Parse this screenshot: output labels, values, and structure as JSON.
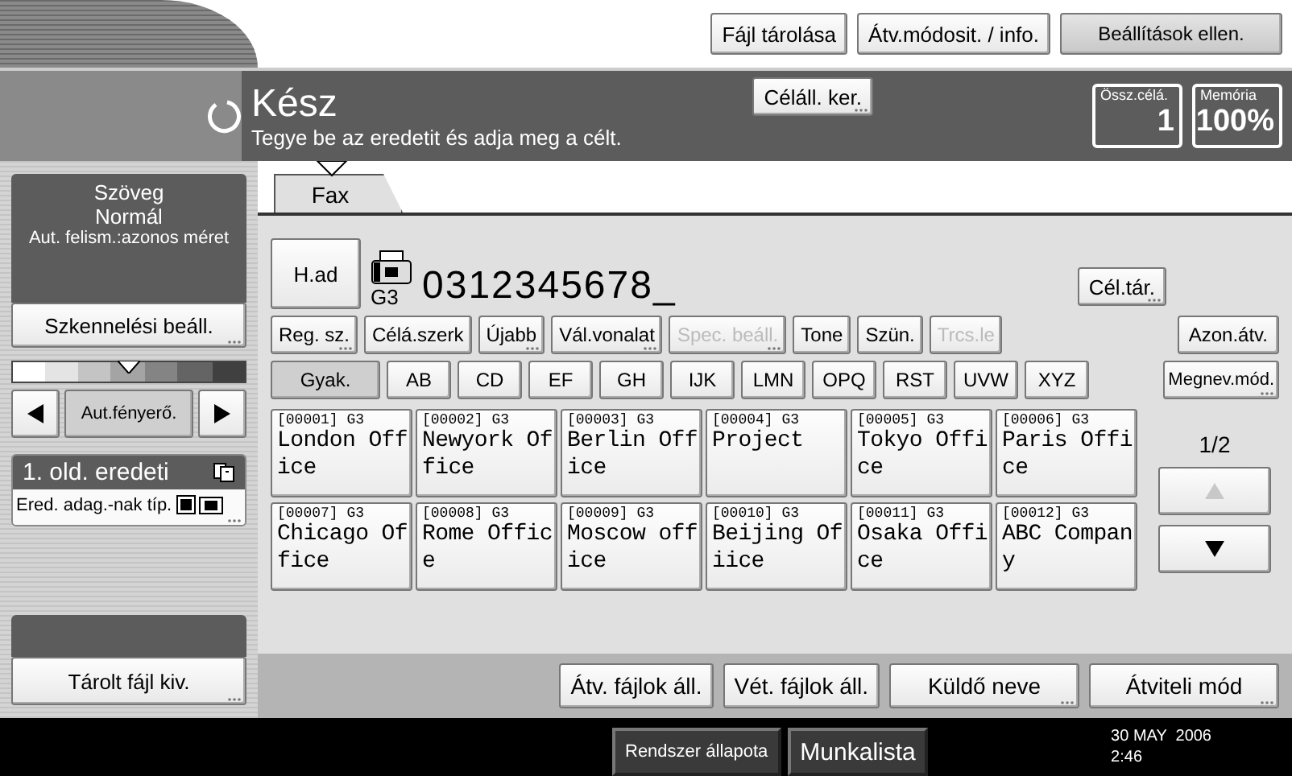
{
  "top_buttons": [
    {
      "label": "Fájl tárolása",
      "kind": "plain"
    },
    {
      "label": "Átv.módosit. / info.",
      "kind": "plain"
    },
    {
      "label": "Beállítások ellen.",
      "kind": "shaded"
    }
  ],
  "status": {
    "title": "Kész",
    "message": "Tegye be az eredetit és adja meg a célt.",
    "button": {
      "label": "Céláll. ker.",
      "more": true
    },
    "counters": [
      {
        "label": "Össz.célá.",
        "value": "1"
      },
      {
        "label": "Memória",
        "value": "100%"
      }
    ]
  },
  "left": {
    "settings": [
      "Szöveg",
      "Normál",
      "Aut. felism.:azonos méret"
    ],
    "scan_button": {
      "label": "Szkennelési beáll.",
      "more": true
    },
    "density": {
      "level": 0.5,
      "button": "Aut.fényerő."
    },
    "original": {
      "title": "1. old. eredeti",
      "button": "Ered. adag.-nak típ.",
      "more": true
    },
    "stored_button": {
      "label": "Tárolt fájl kiv.",
      "more": true
    }
  },
  "tabs": [
    {
      "label": "Fax",
      "selected": true
    }
  ],
  "destination": {
    "button": "H.ad",
    "mode": "G3",
    "number": "0312345678_",
    "store_button": {
      "label": "Cél.tár.",
      "more": true
    }
  },
  "tools": [
    {
      "label": "Reg. sz.",
      "more": true,
      "disabled": false
    },
    {
      "label": "Célá.szerk",
      "more": false,
      "disabled": false
    },
    {
      "label": "Újabb",
      "more": true,
      "disabled": false
    },
    {
      "label": "Vál.vonalat",
      "more": true,
      "disabled": false
    },
    {
      "label": "Spec. beáll.",
      "more": true,
      "disabled": true
    },
    {
      "label": "Tone",
      "more": false,
      "disabled": false
    },
    {
      "label": "Szün.",
      "more": false,
      "disabled": false
    },
    {
      "label": "Trcs.le",
      "more": false,
      "disabled": true
    },
    {
      "label": "Azon.átv.",
      "more": false,
      "disabled": false
    }
  ],
  "index_tabs": [
    {
      "label": "Gyak.",
      "selected": true
    },
    {
      "label": "AB",
      "selected": false
    },
    {
      "label": "CD",
      "selected": false
    },
    {
      "label": "EF",
      "selected": false
    },
    {
      "label": "GH",
      "selected": false
    },
    {
      "label": "IJK",
      "selected": false
    },
    {
      "label": "LMN",
      "selected": false
    },
    {
      "label": "OPQ",
      "selected": false
    },
    {
      "label": "RST",
      "selected": false
    },
    {
      "label": "UVW",
      "selected": false
    },
    {
      "label": "XYZ",
      "selected": false
    }
  ],
  "rename_button": {
    "label": "Megnev.mód.",
    "more": true
  },
  "entries": [
    {
      "code": "[00001]",
      "mode": "G3",
      "name": "London Office"
    },
    {
      "code": "[00002]",
      "mode": "G3",
      "name": "Newyork Office"
    },
    {
      "code": "[00003]",
      "mode": "G3",
      "name": "Berlin Office"
    },
    {
      "code": "[00004]",
      "mode": "G3",
      "name": "Project"
    },
    {
      "code": "[00005]",
      "mode": "G3",
      "name": "Tokyo Office"
    },
    {
      "code": "[00006]",
      "mode": "G3",
      "name": "Paris Office"
    },
    {
      "code": "[00007]",
      "mode": "G3",
      "name": "Chicago Office"
    },
    {
      "code": "[00008]",
      "mode": "G3",
      "name": "Rome Office"
    },
    {
      "code": "[00009]",
      "mode": "G3",
      "name": "Moscow office"
    },
    {
      "code": "[00010]",
      "mode": "G3",
      "name": "Beijing Ofiice"
    },
    {
      "code": "[00011]",
      "mode": "G3",
      "name": "Osaka Office"
    },
    {
      "code": "[00012]",
      "mode": "G3",
      "name": "ABC Company"
    }
  ],
  "pager": {
    "page": "1/2",
    "up_disabled": true,
    "down_disabled": false
  },
  "bottom_buttons": [
    {
      "label": "Átv. fájlok áll.",
      "more": false
    },
    {
      "label": "Vét. fájlok áll.",
      "more": false
    },
    {
      "label": "Küldő neve",
      "more": true
    },
    {
      "label": "Átviteli mód",
      "more": true
    }
  ],
  "footer": {
    "buttons": [
      "Rendszer állapota",
      "Munkalista"
    ],
    "date": "30 MAY  2006",
    "time": "2:46"
  }
}
